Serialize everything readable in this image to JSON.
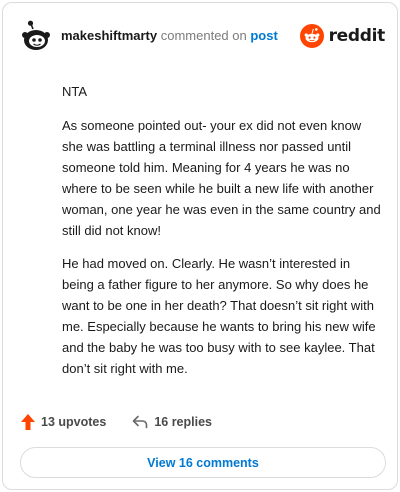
{
  "header": {
    "username": "makeshiftmarty",
    "action": "commented on",
    "target": "post",
    "brand": "reddit"
  },
  "comment": {
    "paragraphs": [
      "NTA",
      "As someone pointed out- your ex did not even know she was battling a terminal illness nor passed until someone told him. Meaning for 4 years he was no where to be seen while he built a new life with another woman, one year he was even in the same country and still did not know!",
      "He had moved on. Clearly. He wasn’t interested in being a father figure to her anymore. So why does he want to be one in her death? That doesn’t sit right with me. Especially because he wants to bring his new wife and the baby he was too busy with to see kaylee. That don’t sit right with me."
    ]
  },
  "stats": {
    "upvotes": "13 upvotes",
    "replies": "16 replies"
  },
  "footer": {
    "view_comments": "View 16 comments"
  },
  "colors": {
    "accent": "#0079d3",
    "upvote": "#ff4500",
    "reddit_orange": "#ff4500"
  },
  "icons": {
    "avatar": "snoo-avatar-icon",
    "logo": "reddit-logo-icon",
    "upvote": "upvote-arrow-icon",
    "reply": "reply-arrow-icon"
  }
}
